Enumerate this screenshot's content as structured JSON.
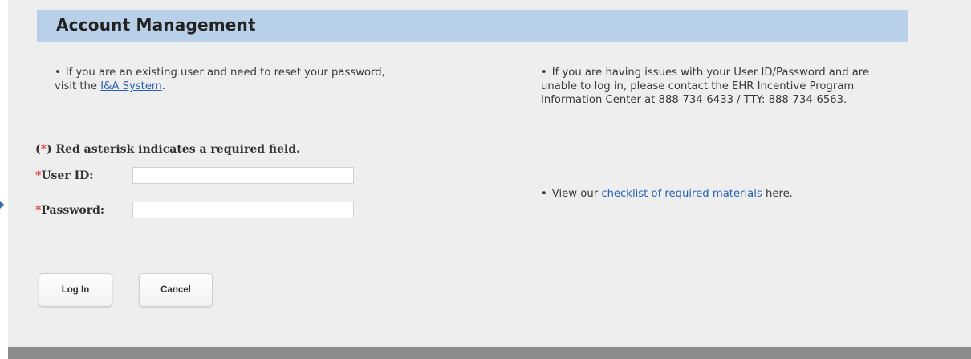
{
  "header": {
    "title": "Account Management"
  },
  "info_left": {
    "bullet": "•",
    "text_before": "If you are an existing user and need to reset your password, visit the",
    "link_label": "I&A System",
    "text_after": "."
  },
  "info_right": {
    "bullet": "•",
    "text": "If you are having issues with your User ID/Password and are unable to log in, please contact the EHR Incentive Program Information Center at 888-734-6433 / TTY: 888-734-6563."
  },
  "info_mid": {
    "bullet": "•",
    "text_before": "View our",
    "link_label": "checklist of required materials",
    "text_after": "here."
  },
  "form": {
    "required_note_open": "(",
    "required_asterisk": "*",
    "required_note_text": ") Red asterisk indicates a required field.",
    "user_id_asterisk": "*",
    "user_id_label": "User ID:",
    "user_id_value": "",
    "password_asterisk": "*",
    "password_label": "Password:",
    "password_value": ""
  },
  "buttons": {
    "login_label": "Log In",
    "cancel_label": "Cancel"
  },
  "colors": {
    "header_bg": "#b9d1e8",
    "link": "#2a61b8",
    "required_red": "#e8413e",
    "page_bg": "#eeeeee"
  }
}
